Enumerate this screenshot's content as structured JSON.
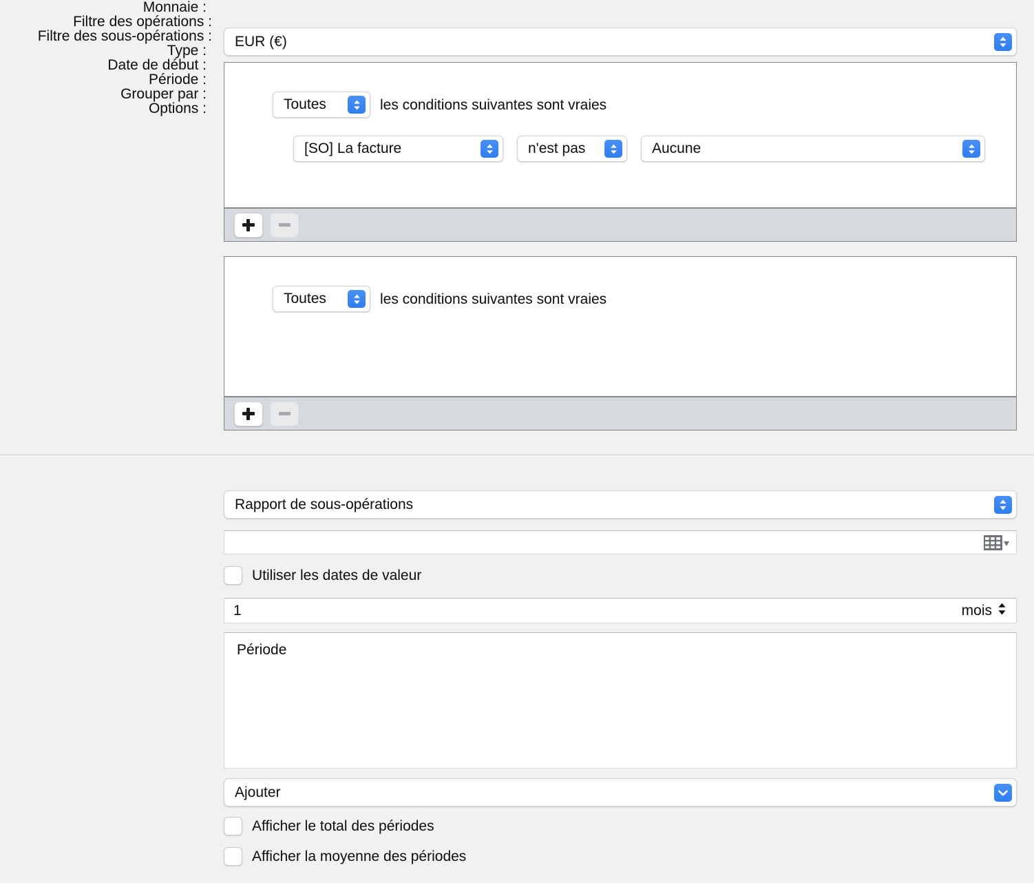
{
  "currency": {
    "label": "Monnaie :",
    "value": "EUR (€)",
    "stepper_icon": "chevron-updown-icon"
  },
  "operations_filter": {
    "label": "Filtre des opérations :",
    "match_selector": {
      "value": "Toutes",
      "stepper_icon": "chevron-updown-icon"
    },
    "match_suffix": "les conditions suivantes sont vraies",
    "conditions": [
      {
        "field": "[SO] La facture",
        "operator": "n'est pas",
        "value": "Aucune"
      }
    ],
    "toolbar": {
      "add_label": "+",
      "remove_label": "−",
      "add_enabled": true,
      "remove_enabled": false
    }
  },
  "suboperations_filter": {
    "label": "Filtre des sous-opérations :",
    "match_selector": {
      "value": "Toutes",
      "stepper_icon": "chevron-updown-icon"
    },
    "match_suffix": "les conditions suivantes sont vraies",
    "conditions": [],
    "toolbar": {
      "add_label": "+",
      "remove_label": "−",
      "add_enabled": true,
      "remove_enabled": false
    }
  },
  "report": {
    "type": {
      "label": "Type :",
      "value": "Rapport de sous-opérations",
      "stepper_icon": "chevron-updown-icon"
    },
    "start_date": {
      "label": "Date de début :",
      "value": "",
      "placeholder": "",
      "icon": "calendar-icon"
    },
    "use_value_dates": {
      "label": "Utiliser les dates de valeur",
      "checked": false
    },
    "period": {
      "label": "Période :",
      "value": "1",
      "unit": "mois",
      "stepper_icon": "chevron-updown-icon"
    },
    "group_by": {
      "label": "Grouper par :",
      "items": [
        "Période"
      ]
    },
    "add_menu": {
      "value": "Ajouter",
      "stepper_icon": "chevron-down-icon"
    },
    "options": {
      "label": "Options :",
      "items": [
        {
          "label": "Afficher le total des périodes",
          "checked": false
        },
        {
          "label": "Afficher la moyenne des périodes",
          "checked": false
        }
      ]
    }
  },
  "colors": {
    "accent": "#3b82f6",
    "window_bg": "#f1f1f1",
    "box_border": "#858585",
    "toolbar_bg": "#d6d9dd"
  }
}
